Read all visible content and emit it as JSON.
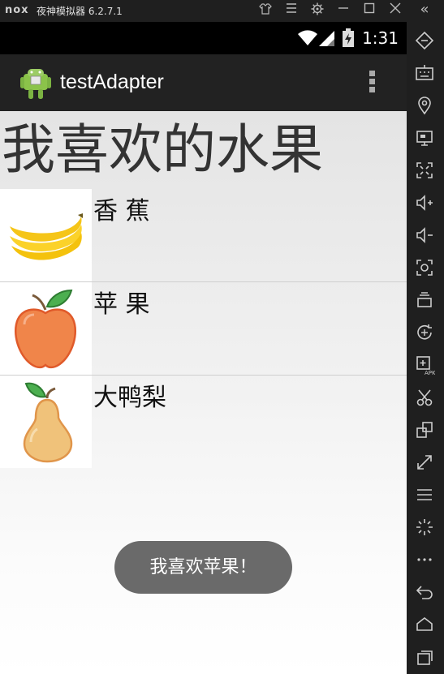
{
  "emulator": {
    "logo": "nox",
    "title": "夜神模拟器 6.2.7.1",
    "collapse_glyph": "«"
  },
  "status_bar": {
    "time": "1:31"
  },
  "action_bar": {
    "app_title": "testAdapter"
  },
  "page": {
    "heading": "我喜欢的水果"
  },
  "fruits": [
    {
      "name": "香 蕉",
      "icon": "banana-icon"
    },
    {
      "name": "苹 果",
      "icon": "apple-icon"
    },
    {
      "name": "大鸭梨",
      "icon": "pear-icon"
    }
  ],
  "toast": {
    "message": "我喜欢苹果！"
  },
  "colors": {
    "toast_bg": "#6a6a6a",
    "action_bar_bg": "#222222",
    "emulator_chrome": "#1f1f1f"
  }
}
